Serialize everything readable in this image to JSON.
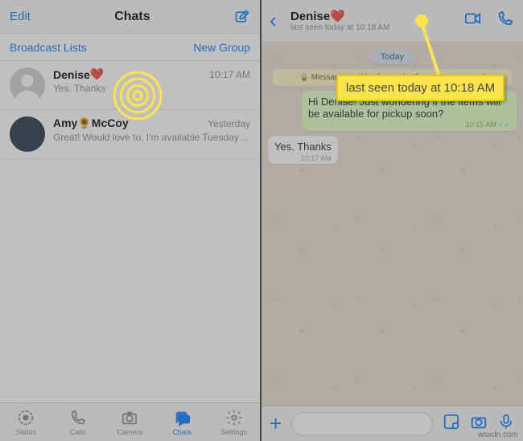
{
  "left": {
    "edit": "Edit",
    "title": "Chats",
    "broadcast": "Broadcast Lists",
    "newgroup": "New Group",
    "rows": [
      {
        "name": "Denise",
        "heart": "❤️",
        "time": "10:17 AM",
        "preview": "Yes. Thanks"
      },
      {
        "name": "Amy🌻McCoy",
        "heart": "",
        "time": "Yesterday",
        "preview": "Great!  Would love to, I'm available Tuesday or Wednesday, what's b…"
      }
    ],
    "tabs": [
      "Status",
      "Calls",
      "Camera",
      "Chats",
      "Settings"
    ]
  },
  "right": {
    "name": "Denise",
    "heart": "❤️",
    "seen": "last seen today at 10:18 AM",
    "today": "Today",
    "enc": "Messages to this chat and calls are now secured",
    "out": {
      "text": "Hi Denise! Just wondering if the items will be available for pickup soon?",
      "time": "10:15 AM"
    },
    "in": {
      "text": "Yes. Thanks",
      "time": "10:17 AM"
    }
  },
  "callout": "last seen today at 10:18 AM",
  "watermark": "wsxdn.com"
}
